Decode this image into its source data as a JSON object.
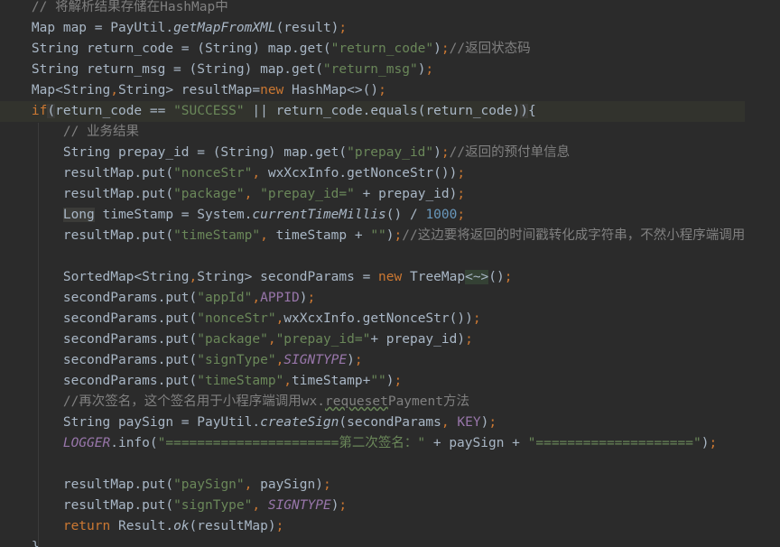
{
  "editor": {
    "language": "Java",
    "theme_colors": {
      "background": "#2b2b2b",
      "keyword": "#cc7832",
      "string": "#6a8759",
      "comment": "#808080",
      "constant": "#9876aa",
      "number": "#6897bb",
      "text": "#a9b7c6"
    },
    "lines": [
      "    // 将解析结果存储在HashMap中",
      "    Map map = PayUtil.getMapFromXML(result);",
      "    String return_code = (String) map.get(\"return_code\");//返回状态码",
      "    String return_msg = (String) map.get(\"return_msg\");",
      "    Map<String,String> resultMap=new HashMap<>();",
      "    if(return_code == \"SUCCESS\" || return_code.equals(return_code)){",
      "        // 业务结果",
      "        String prepay_id = (String) map.get(\"prepay_id\");//返回的预付单信息",
      "        resultMap.put(\"nonceStr\", wxXcxInfo.getNonceStr());",
      "        resultMap.put(\"package\", \"prepay_id=\" + prepay_id);",
      "        Long timeStamp = System.currentTimeMillis() / 1000;",
      "        resultMap.put(\"timeStamp\", timeStamp + \"\");//这边要将返回的时间戳转化成字符串，不然小程序端调用",
      "",
      "        SortedMap<String,String> secondParams = new TreeMap<~>();",
      "        secondParams.put(\"appId\",APPID);",
      "        secondParams.put(\"nonceStr\",wxXcxInfo.getNonceStr());",
      "        secondParams.put(\"package\",\"prepay_id=\"+ prepay_id);",
      "        secondParams.put(\"signType\",SIGNTYPE);",
      "        secondParams.put(\"timeStamp\",timeStamp+\"\");",
      "        //再次签名，这个签名用于小程序端调用wx.requesetPayment方法",
      "        String paySign = PayUtil.createSign(secondParams, KEY);",
      "        LOGGER.info(\"======================第二次签名：\" + paySign + \"====================\");",
      "",
      "        resultMap.put(\"paySign\", paySign);",
      "        resultMap.put(\"signType\", SIGNTYPE);",
      "        return Result.ok(resultMap);",
      "    }"
    ]
  }
}
